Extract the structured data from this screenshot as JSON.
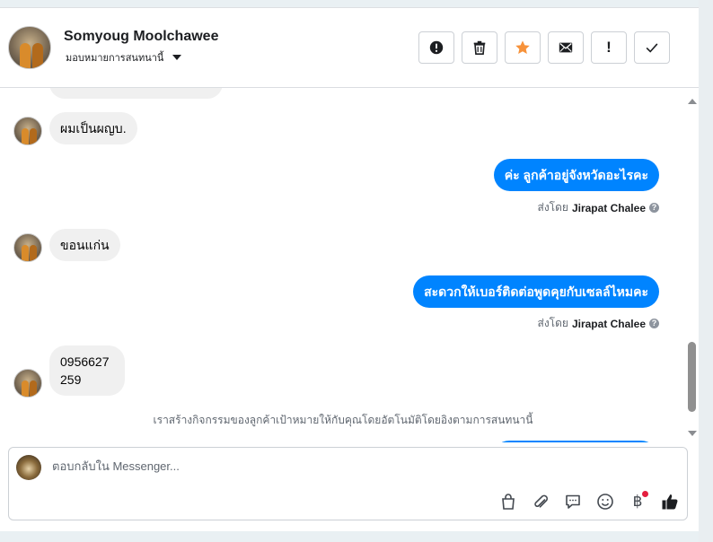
{
  "header": {
    "contact_name": "Somyoug Moolchawee",
    "assign_label": "มอบหมายการสนทนานี้",
    "actions": [
      {
        "name": "report-spam-button",
        "icon": "alert-circle-icon"
      },
      {
        "name": "delete-button",
        "icon": "trash-icon"
      },
      {
        "name": "star-button",
        "icon": "star-icon"
      },
      {
        "name": "mark-unread-button",
        "icon": "envelope-icon"
      },
      {
        "name": "follow-up-button",
        "icon": "exclamation-icon",
        "label": "!"
      },
      {
        "name": "mark-done-button",
        "icon": "check-icon"
      }
    ]
  },
  "messages": [
    {
      "from": "customer",
      "text": "ผมเป็นผญบ."
    },
    {
      "from": "page",
      "text": "ค่ะ ลูกค้าอยู่จังหวัดอะไรคะ",
      "sent_by_prefix": "ส่งโดย",
      "sent_by_name": "Jirapat Chalee"
    },
    {
      "from": "customer",
      "text": "ขอนแก่น"
    },
    {
      "from": "page",
      "text": "สะดวกให้เบอร์ติดต่อพูดคุยกับเซลล์ไหมคะ",
      "sent_by_prefix": "ส่งโดย",
      "sent_by_name": "Jirapat Chalee"
    },
    {
      "from": "customer",
      "text_line1": "0956627",
      "text_line2": "259"
    }
  ],
  "system_note": "เราสร้างกิจกรรมของลูกค้าเป้าหมายให้กับคุณโดยอัตโนมัติโดยอิงตามการสนทนานี้",
  "composer": {
    "placeholder": "ตอบกลับใน Messenger...",
    "tools": [
      "shopping-bag-icon",
      "paperclip-icon",
      "saved-reply-icon",
      "emoji-icon",
      "baht-payment-icon",
      "like-icon"
    ],
    "baht_symbol": "฿"
  },
  "colors": {
    "accent": "#0084ff",
    "star": "#f7923a",
    "notification_dot": "#e41e3f"
  }
}
